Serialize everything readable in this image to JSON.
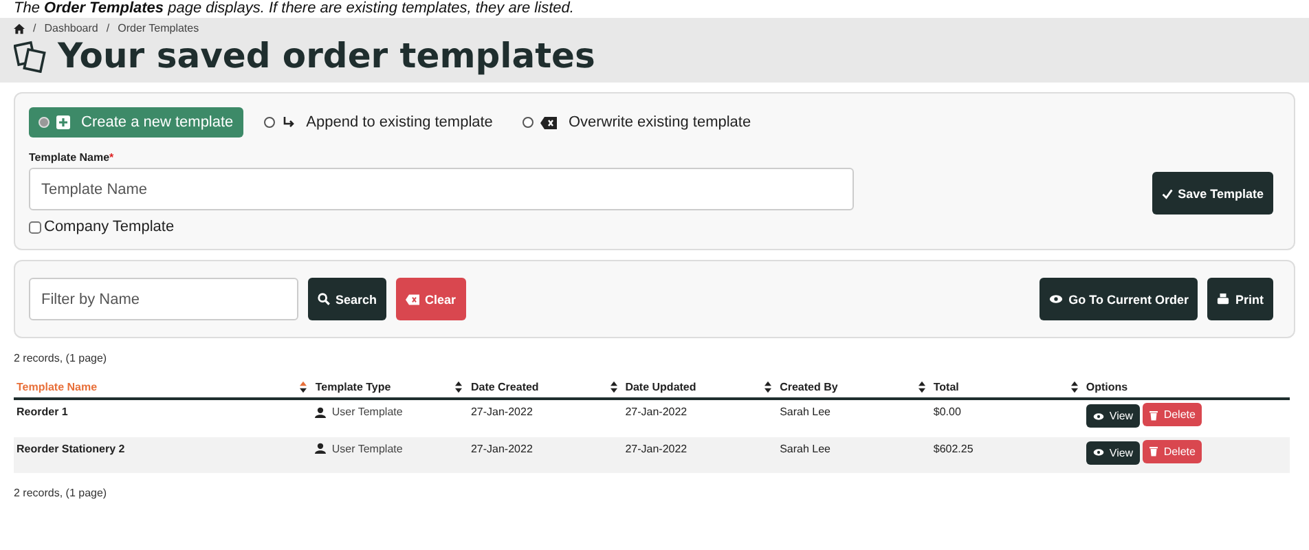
{
  "caption": "The **Order Templates** page displays. If there are existing templates, they are listed.",
  "breadcrumb": [
    {
      "separator": "/",
      "label": "Dashboard"
    },
    {
      "separator": "/",
      "label": "Order Templates"
    }
  ],
  "title": "Your saved order templates",
  "modes": [
    {
      "label": "Create a new template",
      "kind": "create",
      "selected": true
    },
    {
      "label": "Append to existing template",
      "kind": "append",
      "selected": false
    },
    {
      "label": "Overwrite existing template",
      "kind": "overwrite",
      "selected": false
    }
  ],
  "template_name": {
    "label": "Template Name",
    "required_mark": "*",
    "placeholder": "Template Name"
  },
  "company_template": {
    "label": "Company Template",
    "checked": false
  },
  "save_button": "Save Template",
  "filter": {
    "placeholder": "Filter by Name"
  },
  "search_button": "Search",
  "clear_button": "Clear",
  "current_order_button": "Go To Current Order",
  "print_button": "Print",
  "records_top": "2 records, (1 page)",
  "table": {
    "columns": [
      {
        "label": "Template Name",
        "sorted": true
      },
      {
        "label": "Template Type",
        "sorted": false
      },
      {
        "label": "Date Created",
        "sorted": false
      },
      {
        "label": "Date Updated",
        "sorted": false
      },
      {
        "label": "Created By",
        "sorted": false
      },
      {
        "label": "Total",
        "sorted": false
      },
      {
        "label": "Options",
        "sorted": false
      }
    ],
    "rows": [
      {
        "name": "Reorder 1",
        "type": "User Template",
        "created": "27-Jan-2022",
        "updated": "27-Jan-2022",
        "by": "Sarah Lee",
        "total": "$0.00",
        "view": "View",
        "delete": "Delete"
      },
      {
        "name": "Reorder Stationery 2",
        "type": "User Template",
        "created": "27-Jan-2022",
        "updated": "27-Jan-2022",
        "by": "Sarah Lee",
        "total": "$602.25",
        "view": "View",
        "delete": "Delete"
      }
    ]
  },
  "records_bottom": "2 records, (1 page)"
}
